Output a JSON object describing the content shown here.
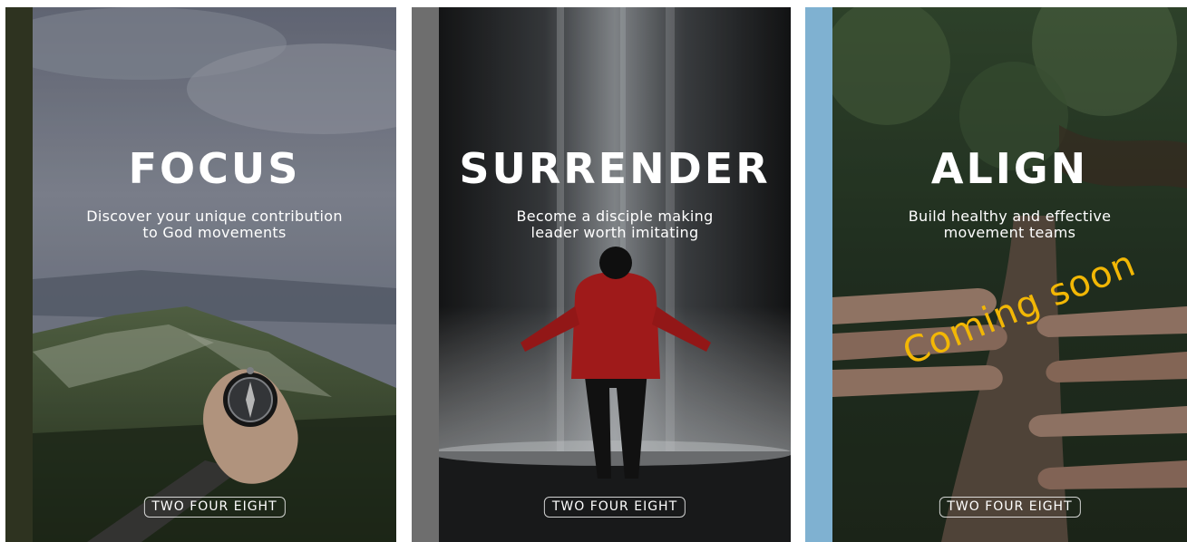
{
  "books": [
    {
      "title": "FOCUS",
      "subtitle": "Discover your unique contribution\nto God movements",
      "brand": "TWO FOUR EIGHT",
      "spine_color": "#2e3320",
      "image": "mountain-compass-photo"
    },
    {
      "title": "SURRENDER",
      "subtitle": "Become a disciple making\nleader worth imitating",
      "brand": "TWO FOUR EIGHT",
      "spine_color": "#6e6e6e",
      "image": "waterfall-person-photo"
    },
    {
      "title": "ALIGN",
      "subtitle": "Build healthy and effective\nmovement teams",
      "brand": "TWO FOUR EIGHT",
      "spine_color": "#7fb1d1",
      "image": "hands-on-tree-photo",
      "badge": "Coming soon",
      "badge_color": "#f2b705"
    }
  ]
}
